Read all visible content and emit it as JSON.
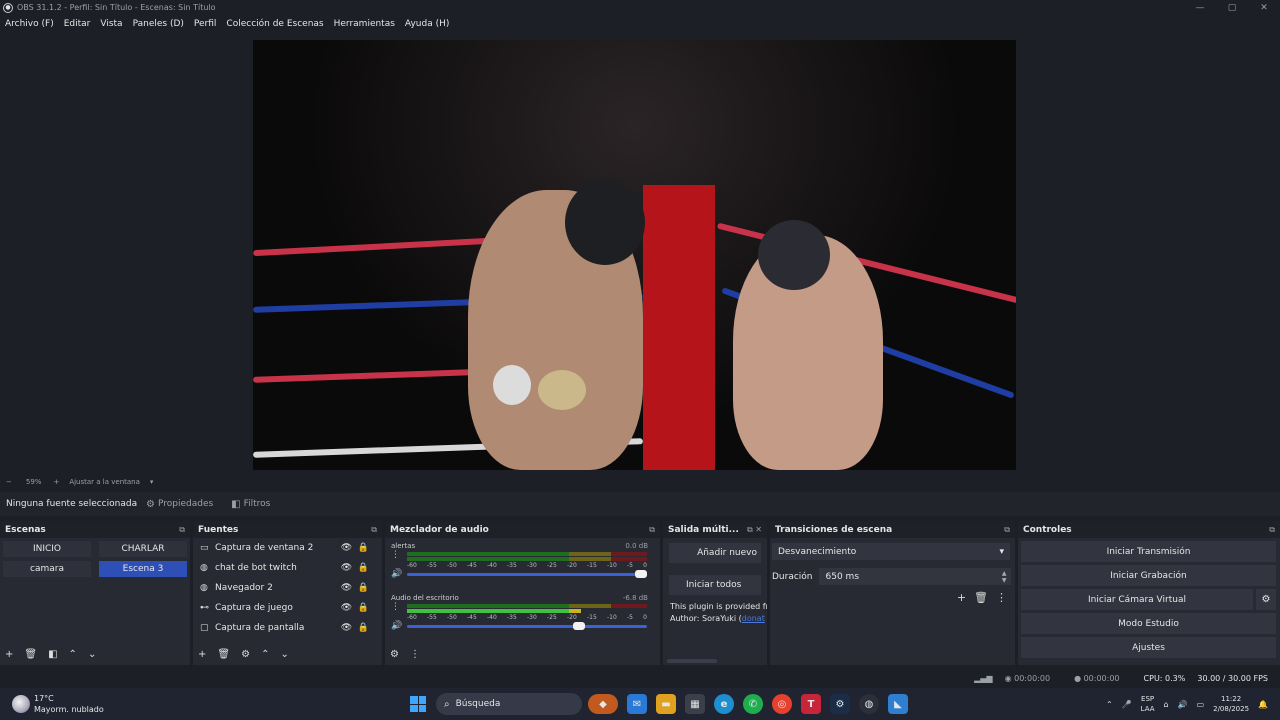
{
  "window": {
    "title": "OBS 31.1.2 - Perfil: Sin Título - Escenas: Sin Título",
    "minimize": "—",
    "maximize": "▢",
    "close": "✕"
  },
  "menu": [
    "Archivo (F)",
    "Editar",
    "Vista",
    "Paneles (D)",
    "Perfil",
    "Colección de Escenas",
    "Herramientas",
    "Ayuda (H)"
  ],
  "zoom": {
    "minus": "−",
    "value": "59%",
    "plus": "+",
    "fit": "Ajustar a la ventana",
    "caret": "▾"
  },
  "source_toolbar": {
    "no_source": "Ninguna fuente seleccionada",
    "properties": "Propiedades",
    "filters": "Filtros"
  },
  "scenes": {
    "title": "Escenas",
    "items": [
      {
        "label": "INICIO",
        "active": false
      },
      {
        "label": "CHARLAR",
        "active": false
      },
      {
        "label": "camara",
        "active": false
      },
      {
        "label": "Escena 3",
        "active": true
      }
    ]
  },
  "sources": {
    "title": "Fuentes",
    "items": [
      {
        "label": "Captura de ventana 2",
        "icon": "window-icon"
      },
      {
        "label": "chat de bot twitch",
        "icon": "globe-icon"
      },
      {
        "label": "Navegador 2",
        "icon": "globe-icon"
      },
      {
        "label": "Captura de juego",
        "icon": "gamepad-icon"
      },
      {
        "label": "Captura de pantalla",
        "icon": "monitor-icon"
      }
    ]
  },
  "mixer": {
    "title": "Mezclador de audio",
    "ticks": [
      "-60",
      "-55",
      "-50",
      "-45",
      "-40",
      "-35",
      "-30",
      "-25",
      "-20",
      "-15",
      "-10",
      "-5",
      "0"
    ],
    "channels": [
      {
        "name": "alertas",
        "db": "0.0 dB",
        "level": 0.0,
        "volume": 1.0
      },
      {
        "name": "Audio del escritorio",
        "db": "-6.8 dB",
        "level": 0.72,
        "volume": 0.73
      }
    ]
  },
  "multi_output": {
    "title": "Salida múlti...",
    "add_new": "Añadir nuevo",
    "start_all": "Iniciar todos",
    "note_line1": "This plugin is provided fr",
    "note_author": "Author: SoraYuki (",
    "note_link": "donat"
  },
  "transitions": {
    "title": "Transiciones de escena",
    "selected": "Desvanecimiento",
    "duration_label": "Duración",
    "duration_value": "650 ms"
  },
  "controls": {
    "title": "Controles",
    "start_stream": "Iniciar Transmisión",
    "start_recording": "Iniciar Grabación",
    "start_virtual_cam": "Iniciar Cámara Virtual",
    "studio_mode": "Modo Estudio",
    "settings": "Ajustes"
  },
  "status": {
    "stream_time": "00:00:00",
    "rec_time": "00:00:00",
    "cpu": "CPU: 0.3%",
    "fps": "30.00 / 30.00 FPS"
  },
  "taskbar": {
    "temp": "17°C",
    "weather": "Mayorm. nublado",
    "search": "Búsqueda",
    "lang1": "ESP",
    "lang2": "LAA",
    "time": "11:22",
    "date": "2/08/2025"
  },
  "colors": {
    "accent": "#2d4fb6",
    "meter_green": "#3fc23f",
    "meter_yellow": "#b5a41c",
    "meter_red": "#b4141a"
  }
}
